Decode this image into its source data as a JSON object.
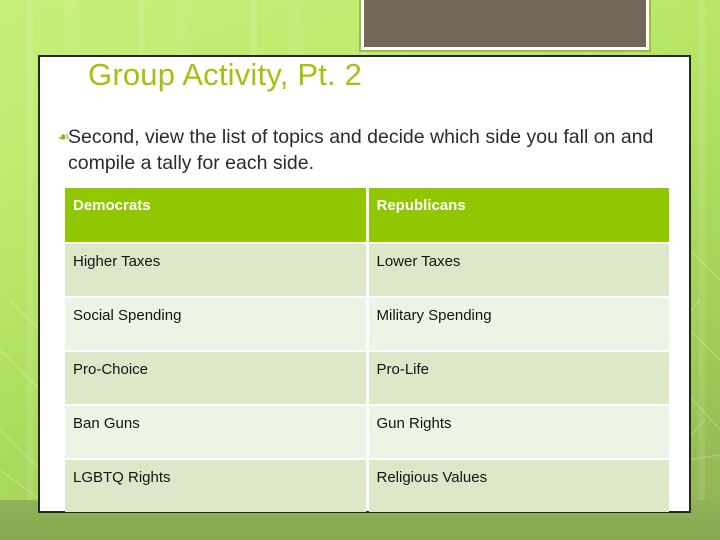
{
  "slide": {
    "title": "Group Activity, Pt. 2",
    "bullet_glyph": "❧",
    "bullet_text": "Second, view the list of topics and decide which side you fall on and compile a tally for each side.",
    "colors": {
      "title_green": "#a0c30d",
      "table_header_green": "#91c700",
      "row_odd": "#dde8c9",
      "row_even": "#eef4e5",
      "deco_block_brown": "#736758",
      "background_top": "#c6ef7b",
      "background_bottom": "#8fb055"
    }
  },
  "table": {
    "headers": [
      "Democrats",
      "Republicans"
    ],
    "rows": [
      [
        "Higher Taxes",
        "Lower Taxes"
      ],
      [
        "Social Spending",
        "Military Spending"
      ],
      [
        "Pro-Choice",
        "Pro-Life"
      ],
      [
        "Ban Guns",
        "Gun Rights"
      ],
      [
        "LGBTQ Rights",
        "Religious Values"
      ]
    ]
  }
}
